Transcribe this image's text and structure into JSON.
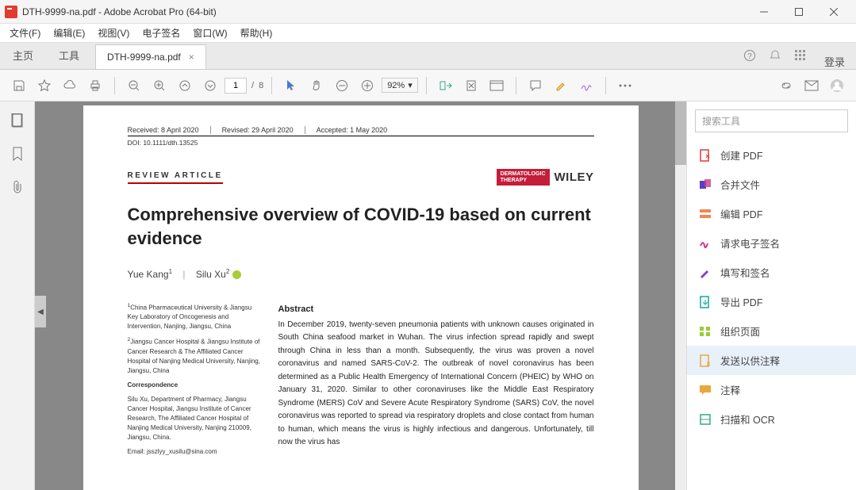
{
  "window": {
    "title": "DTH-9999-na.pdf - Adobe Acrobat Pro (64-bit)"
  },
  "menu": {
    "file": "文件(F)",
    "edit": "编辑(E)",
    "view": "视图(V)",
    "sign": "电子签名",
    "window": "窗口(W)",
    "help": "帮助(H)"
  },
  "tabs": {
    "home": "主页",
    "tools": "工具",
    "file": "DTH-9999-na.pdf",
    "login": "登录"
  },
  "toolbar": {
    "page_current": "1",
    "page_sep": "/",
    "page_total": "8",
    "zoom": "92%"
  },
  "doc": {
    "received": "Received: 8 April 2020",
    "revised": "Revised: 29 April 2020",
    "accepted": "Accepted: 1 May 2020",
    "doi": "DOI: 10.1111/dth.13525",
    "article_type": "REVIEW ARTICLE",
    "journal_badge": "DERMATOLOGIC\nTHERAPY",
    "publisher": "WILEY",
    "title": "Comprehensive overview of COVID-19 based on current evidence",
    "author1": "Yue Kang",
    "author1_sup": "1",
    "author2": "Silu Xu",
    "author2_sup": "2",
    "aff1_sup": "1",
    "aff1": "China Pharmaceutical University & Jiangsu Key Laboratory of Oncogenesis and Intervention, Nanjing, Jiangsu, China",
    "aff2_sup": "2",
    "aff2": "Jiangsu Cancer Hospital & Jiangsu Institute of Cancer Research & The Affiliated Cancer Hospital of Nanjing Medical University, Nanjing, Jiangsu, China",
    "corr_h": "Correspondence",
    "corr": "Silu Xu, Department of Pharmacy, Jiangsu Cancer Hospital, Jiangsu Institute of Cancer Research, The Affiliated Cancer Hospital of Nanjing Medical University, Nanjing 210009, Jiangsu, China.",
    "corr_email": "Email: jsszlyy_xusilu@sina.com",
    "abstract_h": "Abstract",
    "abstract": "In December 2019, twenty-seven pneumonia patients with unknown causes originated in South China seafood market in Wuhan. The virus infection spread rapidly and swept through China in less than a month. Subsequently, the virus was proven a novel coronavirus and named SARS-CoV-2. The outbreak of novel coronavirus has been determined as a Public Health Emergency of International Concern (PHEIC) by WHO on January 31, 2020. Similar to other coronaviruses like the Middle East Respiratory Syndrome (MERS) CoV and Severe Acute Respiratory Syndrome (SARS) CoV, the novel coronavirus was reported to spread via respiratory droplets and close contact from human to human, which means the virus is highly infectious and dangerous. Unfortunately, till now the virus has"
  },
  "right": {
    "search_ph": "搜索工具",
    "items": [
      {
        "label": "创建 PDF"
      },
      {
        "label": "合并文件"
      },
      {
        "label": "编辑 PDF"
      },
      {
        "label": "请求电子签名"
      },
      {
        "label": "填写和签名"
      },
      {
        "label": "导出 PDF"
      },
      {
        "label": "组织页面"
      },
      {
        "label": "发送以供注释"
      },
      {
        "label": "注释"
      },
      {
        "label": "扫描和 OCR"
      }
    ]
  }
}
